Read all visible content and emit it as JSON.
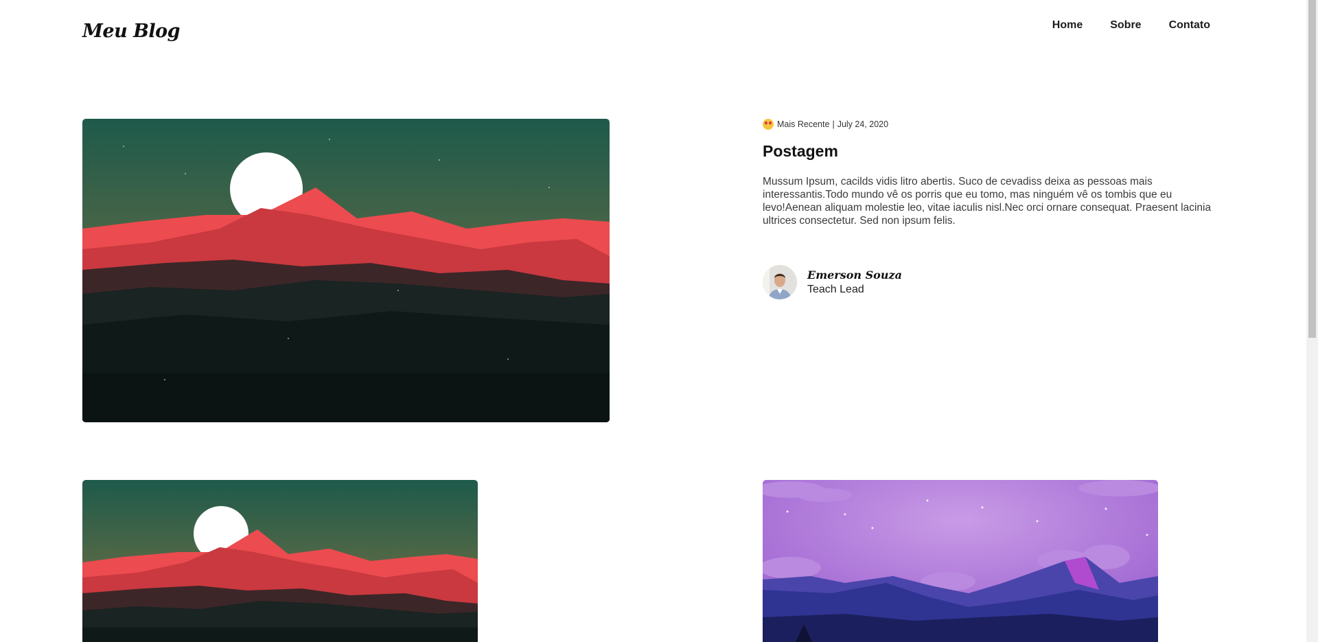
{
  "header": {
    "logo": "Meu Blog",
    "nav": [
      {
        "label": "Home"
      },
      {
        "label": "Sobre"
      },
      {
        "label": "Contato"
      }
    ]
  },
  "featured": {
    "image_icon": "mountain-sunset-illustration",
    "meta": {
      "icon": "star-struck-emoji-icon",
      "tag": "Mais Recente",
      "separator": "|",
      "date": "July 24, 2020"
    },
    "title": "Postagem",
    "excerpt": "Mussum Ipsum, cacilds vidis litro abertis. Suco de cevadiss deixa as pessoas mais interessantis.Todo mundo vê os porris que eu tomo, mas ninguém vê os tombis que eu levo!Aenean aliquam molestie leo, vitae iaculis nisl.Nec orci ornare consequat. Praesent lacinia ultrices consectetur. Sed non ipsum felis.",
    "author": {
      "name": "Emerson Souza",
      "role": "Teach Lead"
    }
  },
  "cards": [
    {
      "image_icon": "mountain-sunset-illustration"
    },
    {
      "image_icon": "purple-mountain-illustration"
    }
  ],
  "colors": {
    "sky_top": "#1f5a4b",
    "sky_bottom": "#6a5d3c",
    "mountain_red": "#e2454a",
    "ground_dark": "#101a18",
    "purple_sky": "#a66fd6",
    "purple_mountain": "#4843a8"
  }
}
